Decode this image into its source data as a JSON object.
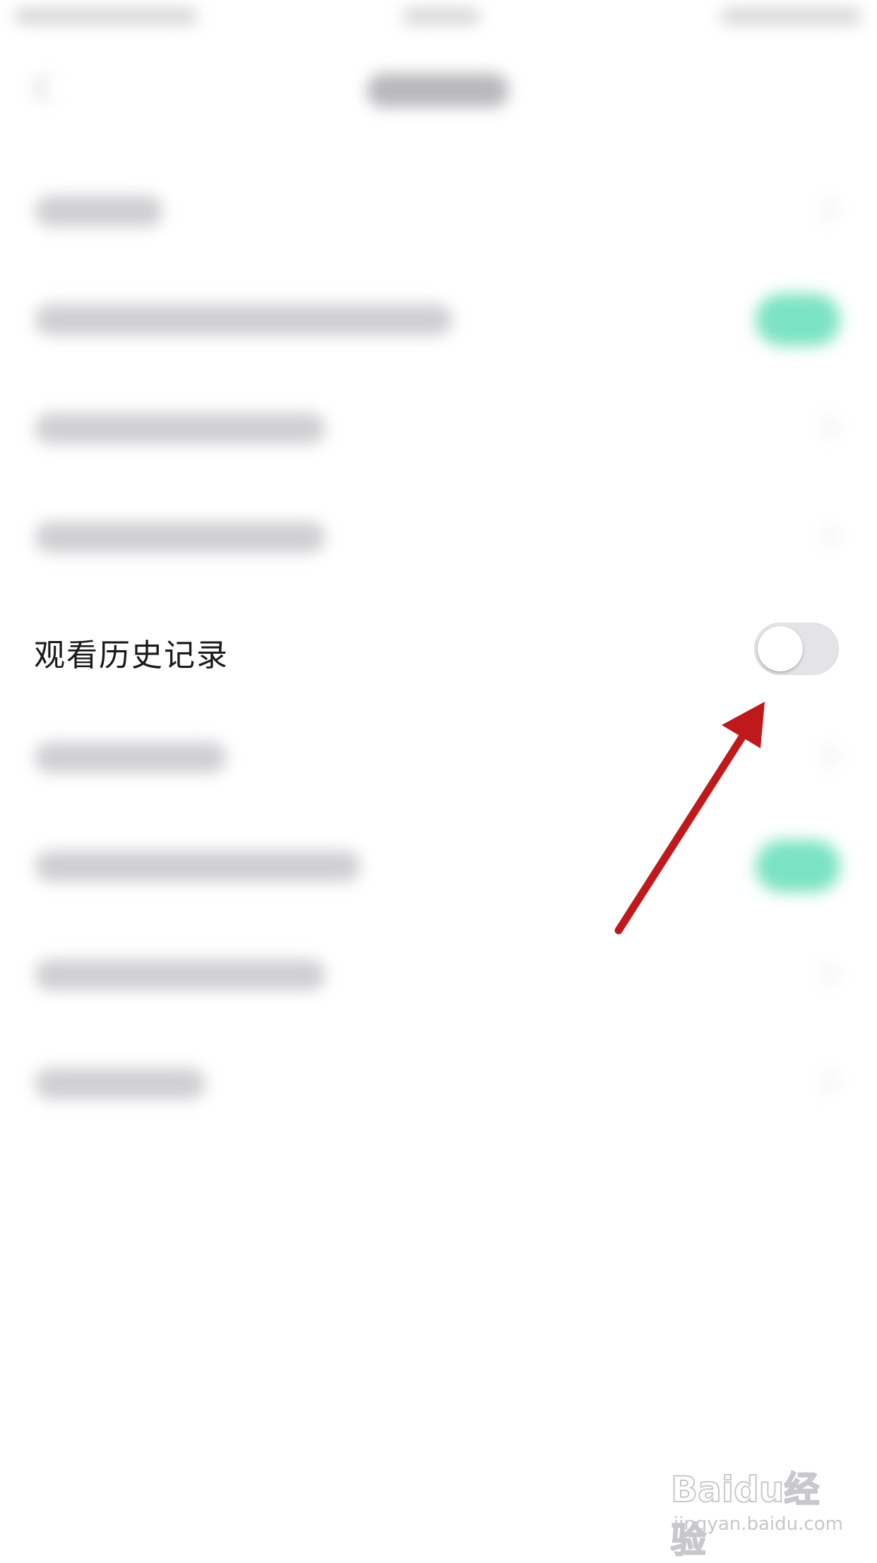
{
  "settings": {
    "history_label": "观看历史记录",
    "history_toggle_on": false
  },
  "annotation": {
    "arrow_color": "#c0191c"
  },
  "watermark": {
    "logo": "Baidu经验",
    "url": "jingyan.baidu.com"
  },
  "colors": {
    "toggle_on": "#7be3c1",
    "toggle_off": "#e4e4e6"
  }
}
